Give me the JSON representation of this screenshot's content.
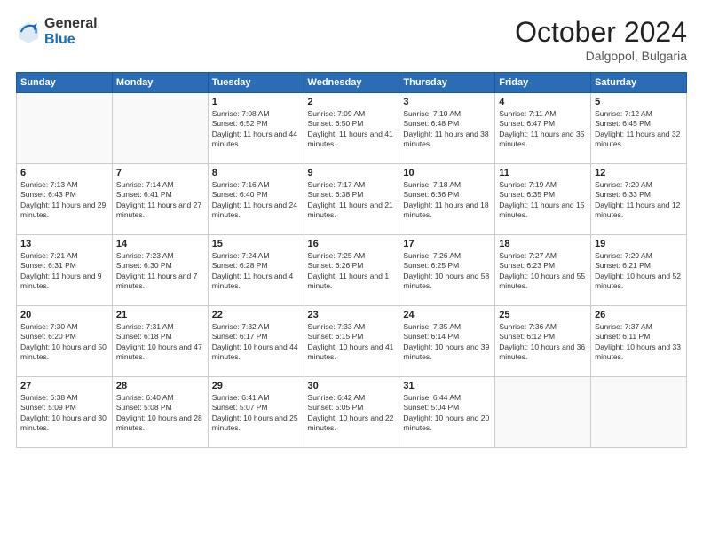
{
  "logo": {
    "general": "General",
    "blue": "Blue"
  },
  "header": {
    "month": "October 2024",
    "location": "Dalgopol, Bulgaria"
  },
  "weekdays": [
    "Sunday",
    "Monday",
    "Tuesday",
    "Wednesday",
    "Thursday",
    "Friday",
    "Saturday"
  ],
  "weeks": [
    [
      {
        "day": "",
        "sunrise": "",
        "sunset": "",
        "daylight": ""
      },
      {
        "day": "",
        "sunrise": "",
        "sunset": "",
        "daylight": ""
      },
      {
        "day": "1",
        "sunrise": "Sunrise: 7:08 AM",
        "sunset": "Sunset: 6:52 PM",
        "daylight": "Daylight: 11 hours and 44 minutes."
      },
      {
        "day": "2",
        "sunrise": "Sunrise: 7:09 AM",
        "sunset": "Sunset: 6:50 PM",
        "daylight": "Daylight: 11 hours and 41 minutes."
      },
      {
        "day": "3",
        "sunrise": "Sunrise: 7:10 AM",
        "sunset": "Sunset: 6:48 PM",
        "daylight": "Daylight: 11 hours and 38 minutes."
      },
      {
        "day": "4",
        "sunrise": "Sunrise: 7:11 AM",
        "sunset": "Sunset: 6:47 PM",
        "daylight": "Daylight: 11 hours and 35 minutes."
      },
      {
        "day": "5",
        "sunrise": "Sunrise: 7:12 AM",
        "sunset": "Sunset: 6:45 PM",
        "daylight": "Daylight: 11 hours and 32 minutes."
      }
    ],
    [
      {
        "day": "6",
        "sunrise": "Sunrise: 7:13 AM",
        "sunset": "Sunset: 6:43 PM",
        "daylight": "Daylight: 11 hours and 29 minutes."
      },
      {
        "day": "7",
        "sunrise": "Sunrise: 7:14 AM",
        "sunset": "Sunset: 6:41 PM",
        "daylight": "Daylight: 11 hours and 27 minutes."
      },
      {
        "day": "8",
        "sunrise": "Sunrise: 7:16 AM",
        "sunset": "Sunset: 6:40 PM",
        "daylight": "Daylight: 11 hours and 24 minutes."
      },
      {
        "day": "9",
        "sunrise": "Sunrise: 7:17 AM",
        "sunset": "Sunset: 6:38 PM",
        "daylight": "Daylight: 11 hours and 21 minutes."
      },
      {
        "day": "10",
        "sunrise": "Sunrise: 7:18 AM",
        "sunset": "Sunset: 6:36 PM",
        "daylight": "Daylight: 11 hours and 18 minutes."
      },
      {
        "day": "11",
        "sunrise": "Sunrise: 7:19 AM",
        "sunset": "Sunset: 6:35 PM",
        "daylight": "Daylight: 11 hours and 15 minutes."
      },
      {
        "day": "12",
        "sunrise": "Sunrise: 7:20 AM",
        "sunset": "Sunset: 6:33 PM",
        "daylight": "Daylight: 11 hours and 12 minutes."
      }
    ],
    [
      {
        "day": "13",
        "sunrise": "Sunrise: 7:21 AM",
        "sunset": "Sunset: 6:31 PM",
        "daylight": "Daylight: 11 hours and 9 minutes."
      },
      {
        "day": "14",
        "sunrise": "Sunrise: 7:23 AM",
        "sunset": "Sunset: 6:30 PM",
        "daylight": "Daylight: 11 hours and 7 minutes."
      },
      {
        "day": "15",
        "sunrise": "Sunrise: 7:24 AM",
        "sunset": "Sunset: 6:28 PM",
        "daylight": "Daylight: 11 hours and 4 minutes."
      },
      {
        "day": "16",
        "sunrise": "Sunrise: 7:25 AM",
        "sunset": "Sunset: 6:26 PM",
        "daylight": "Daylight: 11 hours and 1 minute."
      },
      {
        "day": "17",
        "sunrise": "Sunrise: 7:26 AM",
        "sunset": "Sunset: 6:25 PM",
        "daylight": "Daylight: 10 hours and 58 minutes."
      },
      {
        "day": "18",
        "sunrise": "Sunrise: 7:27 AM",
        "sunset": "Sunset: 6:23 PM",
        "daylight": "Daylight: 10 hours and 55 minutes."
      },
      {
        "day": "19",
        "sunrise": "Sunrise: 7:29 AM",
        "sunset": "Sunset: 6:21 PM",
        "daylight": "Daylight: 10 hours and 52 minutes."
      }
    ],
    [
      {
        "day": "20",
        "sunrise": "Sunrise: 7:30 AM",
        "sunset": "Sunset: 6:20 PM",
        "daylight": "Daylight: 10 hours and 50 minutes."
      },
      {
        "day": "21",
        "sunrise": "Sunrise: 7:31 AM",
        "sunset": "Sunset: 6:18 PM",
        "daylight": "Daylight: 10 hours and 47 minutes."
      },
      {
        "day": "22",
        "sunrise": "Sunrise: 7:32 AM",
        "sunset": "Sunset: 6:17 PM",
        "daylight": "Daylight: 10 hours and 44 minutes."
      },
      {
        "day": "23",
        "sunrise": "Sunrise: 7:33 AM",
        "sunset": "Sunset: 6:15 PM",
        "daylight": "Daylight: 10 hours and 41 minutes."
      },
      {
        "day": "24",
        "sunrise": "Sunrise: 7:35 AM",
        "sunset": "Sunset: 6:14 PM",
        "daylight": "Daylight: 10 hours and 39 minutes."
      },
      {
        "day": "25",
        "sunrise": "Sunrise: 7:36 AM",
        "sunset": "Sunset: 6:12 PM",
        "daylight": "Daylight: 10 hours and 36 minutes."
      },
      {
        "day": "26",
        "sunrise": "Sunrise: 7:37 AM",
        "sunset": "Sunset: 6:11 PM",
        "daylight": "Daylight: 10 hours and 33 minutes."
      }
    ],
    [
      {
        "day": "27",
        "sunrise": "Sunrise: 6:38 AM",
        "sunset": "Sunset: 5:09 PM",
        "daylight": "Daylight: 10 hours and 30 minutes."
      },
      {
        "day": "28",
        "sunrise": "Sunrise: 6:40 AM",
        "sunset": "Sunset: 5:08 PM",
        "daylight": "Daylight: 10 hours and 28 minutes."
      },
      {
        "day": "29",
        "sunrise": "Sunrise: 6:41 AM",
        "sunset": "Sunset: 5:07 PM",
        "daylight": "Daylight: 10 hours and 25 minutes."
      },
      {
        "day": "30",
        "sunrise": "Sunrise: 6:42 AM",
        "sunset": "Sunset: 5:05 PM",
        "daylight": "Daylight: 10 hours and 22 minutes."
      },
      {
        "day": "31",
        "sunrise": "Sunrise: 6:44 AM",
        "sunset": "Sunset: 5:04 PM",
        "daylight": "Daylight: 10 hours and 20 minutes."
      },
      {
        "day": "",
        "sunrise": "",
        "sunset": "",
        "daylight": ""
      },
      {
        "day": "",
        "sunrise": "",
        "sunset": "",
        "daylight": ""
      }
    ]
  ]
}
